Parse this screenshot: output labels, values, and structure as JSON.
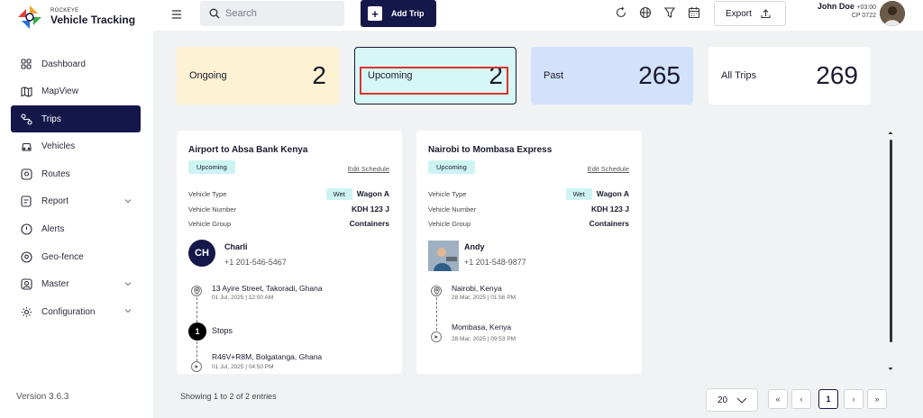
{
  "app": {
    "brand_small": "ROCKEYE",
    "brand_name": "Vehicle Tracking",
    "version": "Version 3.6.3"
  },
  "sidebar": {
    "items": [
      {
        "label": "Dashboard",
        "icon": "grid-icon",
        "active": false
      },
      {
        "label": "MapView",
        "icon": "map-icon",
        "active": false
      },
      {
        "label": "Trips",
        "icon": "route-icon",
        "active": true
      },
      {
        "label": "Vehicles",
        "icon": "car-icon",
        "active": false
      },
      {
        "label": "Routes",
        "icon": "routes-icon",
        "active": false
      },
      {
        "label": "Report",
        "icon": "report-icon",
        "active": false,
        "expandable": true
      },
      {
        "label": "Alerts",
        "icon": "alert-icon",
        "active": false
      },
      {
        "label": "Geo-fence",
        "icon": "location-icon",
        "active": false
      },
      {
        "label": "Master",
        "icon": "user-square-icon",
        "active": false,
        "expandable": true
      },
      {
        "label": "Configuration",
        "icon": "gear-icon",
        "active": false,
        "expandable": true
      }
    ]
  },
  "header": {
    "search_placeholder": "Search",
    "add_trip_label": "Add Trip",
    "export_label": "Export",
    "user_name": "John Doe",
    "timezone": "+03:00",
    "user_sub": "CP 0722"
  },
  "stats": {
    "ongoing": {
      "label": "Ongoing",
      "value": "2"
    },
    "upcoming": {
      "label": "Upcoming",
      "value": "2"
    },
    "past": {
      "label": "Past",
      "value": "265"
    },
    "all": {
      "label": "All Trips",
      "value": "269"
    }
  },
  "trips": [
    {
      "title": "Airport to Absa Bank Kenya",
      "status": "Upcoming",
      "edit_label": "Edit Schedule",
      "vehicle_type_label": "Vehicle Type",
      "vehicle_type_tag": "Wet",
      "vehicle_type": "Wagon A",
      "vehicle_number_label": "Vehicle Number",
      "vehicle_number": "KDH 123 J",
      "vehicle_group_label": "Vehicle Group",
      "vehicle_group": "Containers",
      "driver_initials": "CH",
      "driver_name": "Charli",
      "driver_phone": "+1 201-546-5467",
      "origin": "13 Ayire Street, Takoradi, Ghana",
      "origin_date": "01 Jul, 2025 | 12:00 AM",
      "stops_count": "1",
      "stops_label": "Stops",
      "destination": "R46V+R8M, Bolgatanga, Ghana",
      "destination_date": "01 Jul, 2025 | 04:50 PM"
    },
    {
      "title": "Nairobi to Mombasa Express",
      "status": "Upcoming",
      "edit_label": "Edit Schedule",
      "vehicle_type_label": "Vehicle Type",
      "vehicle_type_tag": "Wet",
      "vehicle_type": "Wagon A",
      "vehicle_number_label": "Vehicle Number",
      "vehicle_number": "KDH 123 J",
      "vehicle_group_label": "Vehicle Group",
      "vehicle_group": "Containers",
      "driver_name": "Andy",
      "driver_phone": "+1 201-548-9877",
      "origin": "Nairobi, Kenya",
      "origin_date": "28 Mar, 2025 | 01:56 PM",
      "destination": "Mombasa, Kenya",
      "destination_date": "28 Mar, 2025 | 09:53 PM"
    }
  ],
  "footer": {
    "entries_text": "Showing 1 to 2 of 2 entries",
    "per_page": "20",
    "current_page": "1"
  },
  "colors": {
    "primary": "#15174a",
    "ongoing_bg": "#fdf3d4",
    "upcoming_bg": "#d6f7f5",
    "past_bg": "#d2e2fb",
    "highlight": "#e03030"
  }
}
